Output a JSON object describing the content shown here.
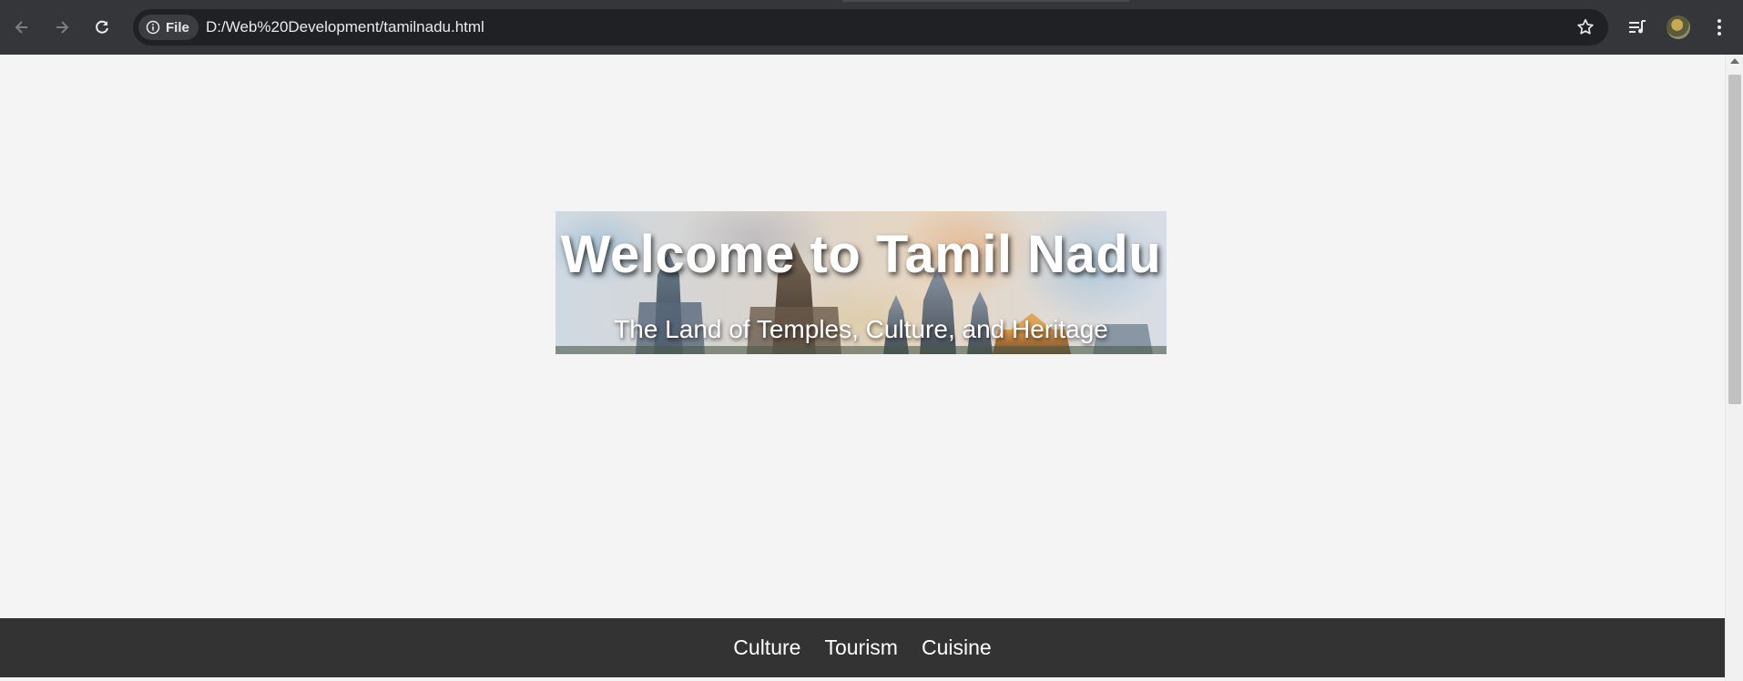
{
  "browser": {
    "chip_label": "File",
    "url": "D:/Web%20Development/tamilnadu.html"
  },
  "hero": {
    "title": "Welcome to Tamil Nadu",
    "subtitle": "The Land of Temples, Culture, and Heritage"
  },
  "nav": {
    "items": [
      {
        "label": "Culture"
      },
      {
        "label": "Tourism"
      },
      {
        "label": "Cuisine"
      }
    ]
  },
  "colors": {
    "chrome": "#35363a",
    "omnibox": "#202124",
    "page_bg": "#f4f4f4",
    "footer_bg": "#333333"
  }
}
